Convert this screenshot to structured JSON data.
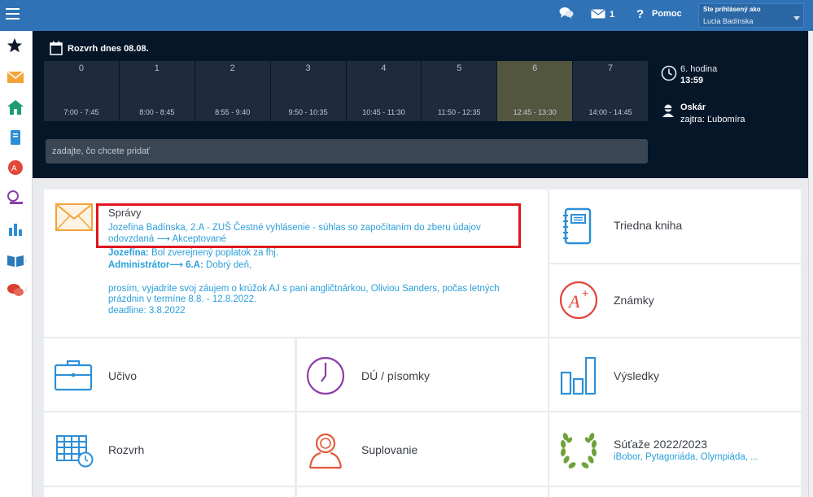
{
  "topbar": {
    "menu_icon": "hamburger-icon",
    "chat_icon": "chat-bubbles-icon",
    "mail_icon": "envelope-icon",
    "mail_count": "1",
    "help_icon": "question-icon",
    "help_label": "Pomoc",
    "user_caption": "Ste prihlásený ako",
    "user_name": "Lucia Badínska"
  },
  "sidebar": {
    "items": [
      {
        "name": "favorites",
        "icon": "star-icon"
      },
      {
        "name": "messages",
        "icon": "envelope-icon"
      },
      {
        "name": "home",
        "icon": "house-icon"
      },
      {
        "name": "class-book",
        "icon": "notebook-icon"
      },
      {
        "name": "grades",
        "icon": "grade-icon"
      },
      {
        "name": "homework",
        "icon": "screen-clock-icon"
      },
      {
        "name": "results",
        "icon": "bar-chart-icon"
      },
      {
        "name": "curriculum",
        "icon": "open-book-icon"
      },
      {
        "name": "communication",
        "icon": "speech-bubbles-icon"
      }
    ]
  },
  "schedule": {
    "title": "Rozvrh dnes 08.08.",
    "periods": [
      {
        "num": "0",
        "time": "7:00 - 7:45"
      },
      {
        "num": "1",
        "time": "8:00 - 8:45"
      },
      {
        "num": "2",
        "time": "8:55 - 9:40"
      },
      {
        "num": "3",
        "time": "9:50 - 10:35"
      },
      {
        "num": "4",
        "time": "10:45 - 11:30"
      },
      {
        "num": "5",
        "time": "11:50 - 12:35"
      },
      {
        "num": "6",
        "time": "12:45 - 13:30"
      },
      {
        "num": "7",
        "time": "14:00 - 14:45"
      }
    ],
    "current_period_index": 6,
    "current_hour_label": "6. hodina",
    "current_time": "13:59",
    "nameday_name": "Oskár",
    "nameday_next": "zajtra: Ľubomíra",
    "input_placeholder": "zadajte, čo chcete pridať"
  },
  "messages": {
    "title": "Správy",
    "line1": "Jozefína Badínska, 2.A - ZUŠ Čestné vyhlásenie - súhlas so započítaním do zberu údajov",
    "line2": "odovzdaná ⟶ Akceptované",
    "line3_sender": "Jozefína:",
    "line3_text": " Bol zverejnený poplatok za fhj.",
    "line4_sender": "Administrátor⟶ 6.A:",
    "line4_text": " Dobrý deň,",
    "line5": "prosím, vyjadrite svoj záujem o krúžok AJ s pani angličtnárkou, Oliviou Sanders, počas letných",
    "line6": "prázdnin v termíne 8.8. - 12.8.2022.",
    "line7": "deadline: 3.8.2022"
  },
  "tiles": {
    "class_book": "Triedna kniha",
    "grades": "Známky",
    "curriculum": "Učivo",
    "homework": "DÚ / písomky",
    "results": "Výsledky",
    "timetable": "Rozvrh",
    "substitutions": "Suplovanie",
    "competitions": "Súťaže 2022/2023",
    "competitions_sub": "iBobor, Pytagoriáda, Olympiáda, ..."
  },
  "colors": {
    "topbar": "#2f72b5",
    "dark": "#061629",
    "accent_blue": "#2b9fd9",
    "current_period": "#53563f",
    "highlight": "#e0161e"
  }
}
